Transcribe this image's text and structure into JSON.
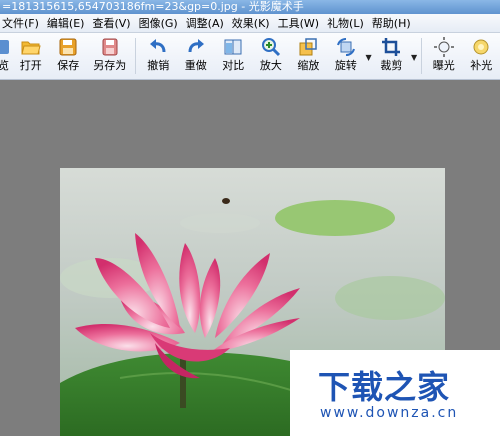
{
  "window": {
    "title": "=181315615,654703186fm=23&gp=0.jpg - 光影魔术手"
  },
  "menu": {
    "items": [
      "文件(F)",
      "编辑(E)",
      "查看(V)",
      "图像(G)",
      "调整(A)",
      "效果(K)",
      "工具(W)",
      "礼物(L)",
      "帮助(H)"
    ]
  },
  "toolbar": {
    "buttons": [
      "预览",
      "打开",
      "保存",
      "另存为",
      "撤销",
      "重做",
      "对比",
      "放大",
      "缩放",
      "旋转",
      "裁剪",
      "曝光",
      "补光"
    ]
  },
  "watermark": {
    "title": "下载之家",
    "url": "www.downza.cn"
  },
  "colors": {
    "title_bar": "#6a9bd3",
    "workspace": "#7d7d7d",
    "watermark_text": "#1e54b4"
  }
}
